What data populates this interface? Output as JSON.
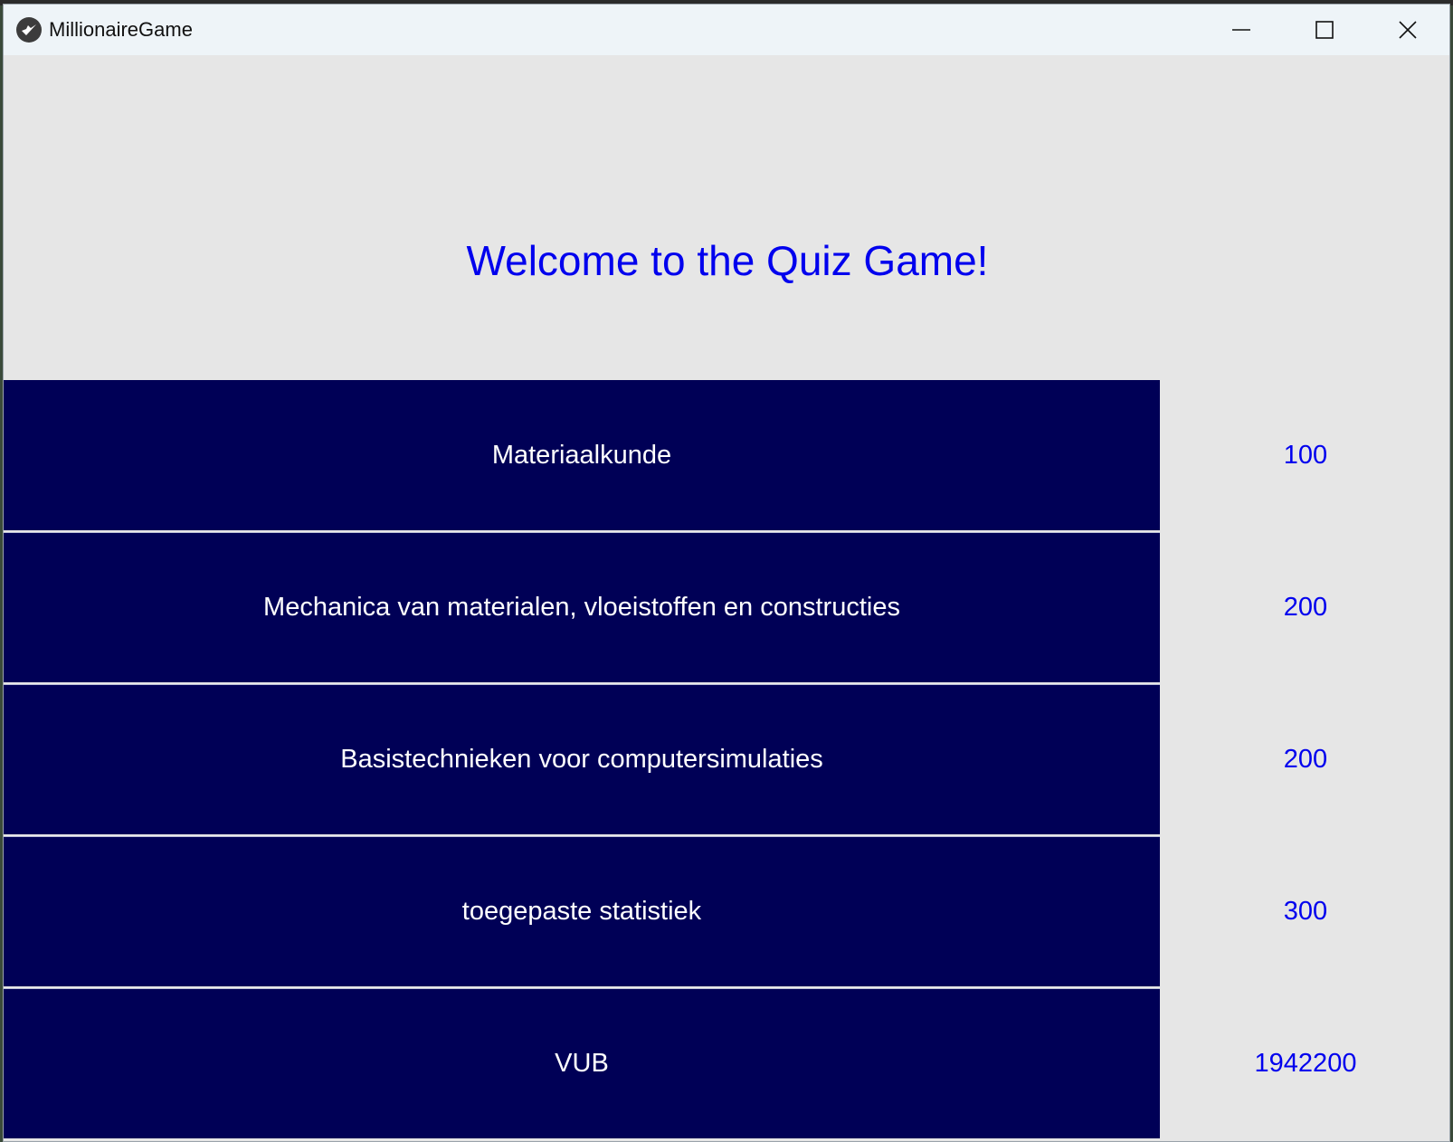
{
  "window": {
    "title": "MillionaireGame",
    "icon": "kivy-logo-icon",
    "controls": [
      "minimize-icon",
      "maximize-icon",
      "close-icon"
    ]
  },
  "main": {
    "heading": "Welcome to the Quiz Game!",
    "categories": [
      {
        "label": "Materiaalkunde",
        "score": "100"
      },
      {
        "label": "Mechanica van materialen, vloeistoffen en constructies",
        "score": "200"
      },
      {
        "label": "Basistechnieken voor computersimulaties",
        "score": "200"
      },
      {
        "label": "toegepaste statistiek",
        "score": "300"
      },
      {
        "label": "VUB",
        "score": "1942200"
      }
    ]
  },
  "colors": {
    "button_bg": "#000056",
    "button_text": "#ffffff",
    "accent_text": "#0000ee",
    "window_bg": "#e6e6e6",
    "titlebar_bg": "#eef4f8"
  }
}
